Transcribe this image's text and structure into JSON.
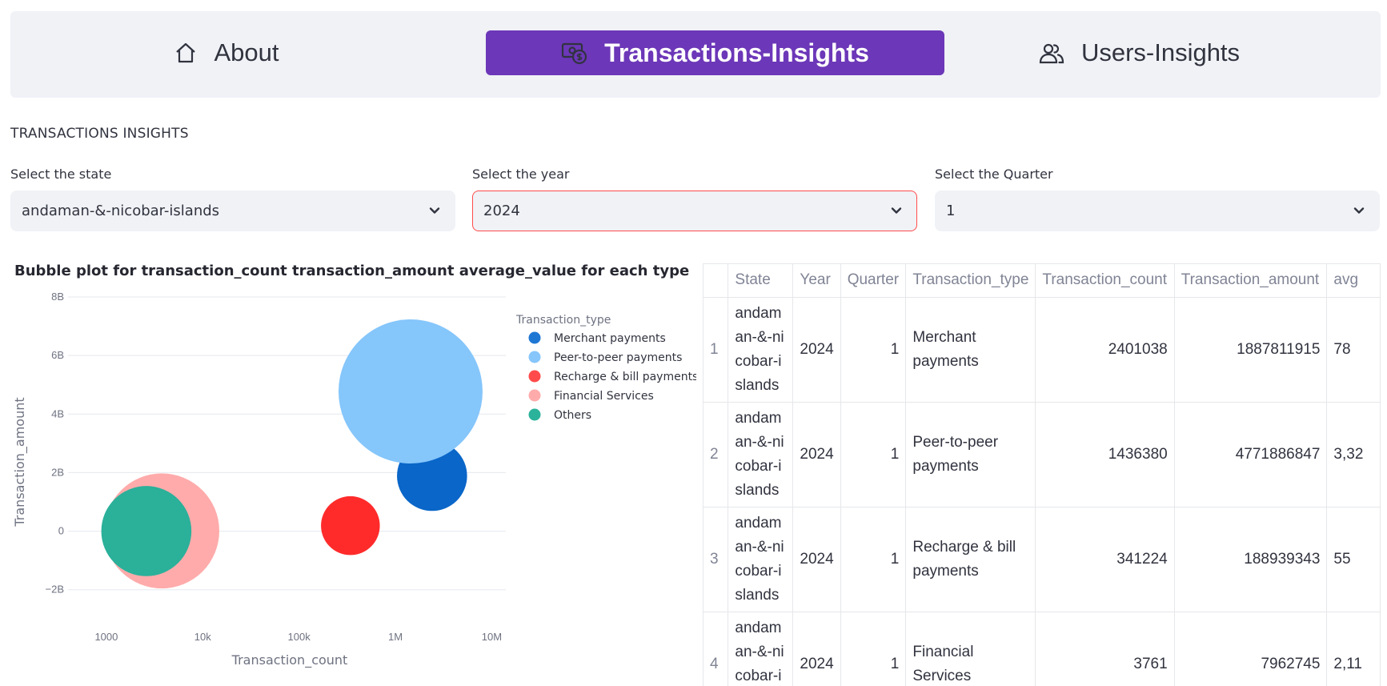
{
  "nav": {
    "about": "About",
    "transactions": "Transactions-Insights",
    "users": "Users-Insights",
    "active_color": "#6c37b8"
  },
  "section_title": "TRANSACTIONS INSIGHTS",
  "filters": {
    "state": {
      "label": "Select the state",
      "value": "andaman-&-nicobar-islands"
    },
    "year": {
      "label": "Select the year",
      "value": "2024"
    },
    "quarter": {
      "label": "Select the Quarter",
      "value": "1"
    }
  },
  "chart_title": "Bubble plot for transaction_count transaction_amount average_value for each type",
  "chart_data": {
    "type": "scatter",
    "xlabel": "Transaction_count",
    "ylabel": "Transaction_amount",
    "x_scale": "log",
    "xlim": [
      400,
      14000000
    ],
    "ylim": [
      -2500000000,
      8300000000
    ],
    "x_ticks": [
      1000,
      10000,
      100000,
      1000000,
      10000000
    ],
    "x_tick_labels": [
      "1000",
      "10k",
      "100k",
      "1M",
      "10M"
    ],
    "y_ticks": [
      -2000000000,
      0,
      2000000000,
      4000000000,
      6000000000,
      8000000000
    ],
    "y_tick_labels": [
      "−2B",
      "0",
      "2B",
      "4B",
      "6B",
      "8B"
    ],
    "legend_title": "Transaction_type",
    "legend_position": "right",
    "series": [
      {
        "name": "Merchant payments",
        "color": "#1f77d4",
        "bubble_color": "#0a66c8",
        "x": 2401038,
        "y": 1887811915,
        "size": 786
      },
      {
        "name": "Peer-to-peer payments",
        "color": "#87c6fb",
        "bubble_color": "#85c6fb",
        "x": 1436380,
        "y": 4771886847,
        "size": 3322
      },
      {
        "name": "Recharge & bill payments",
        "color": "#ff4b4b",
        "bubble_color": "#ff2b2b",
        "x": 341224,
        "y": 188939343,
        "size": 554
      },
      {
        "name": "Financial Services",
        "color": "#ffabab",
        "bubble_color": "#ffabab",
        "x": 3761,
        "y": 7962745,
        "size": 2117
      },
      {
        "name": "Others",
        "color": "#2bb29a",
        "bubble_color": "#2bb09a",
        "x": 2600,
        "y": 2500000,
        "size": 1300
      }
    ]
  },
  "table": {
    "columns": [
      "",
      "State",
      "Year",
      "Quarter",
      "Transaction_type",
      "Transaction_count",
      "Transaction_amount",
      "avg"
    ],
    "rows": [
      [
        "1",
        "andaman-&-nicobar-islands",
        "2024",
        "1",
        "Merchant payments",
        "2401038",
        "1887811915",
        "78"
      ],
      [
        "2",
        "andaman-&-nicobar-islands",
        "2024",
        "1",
        "Peer-to-peer payments",
        "1436380",
        "4771886847",
        "3,32"
      ],
      [
        "3",
        "andaman-&-nicobar-islands",
        "2024",
        "1",
        "Recharge & bill payments",
        "341224",
        "188939343",
        "55"
      ],
      [
        "4",
        "andaman-&-nicobar-islands",
        "2024",
        "1",
        "Financial Services",
        "3761",
        "7962745",
        "2,11"
      ]
    ]
  }
}
